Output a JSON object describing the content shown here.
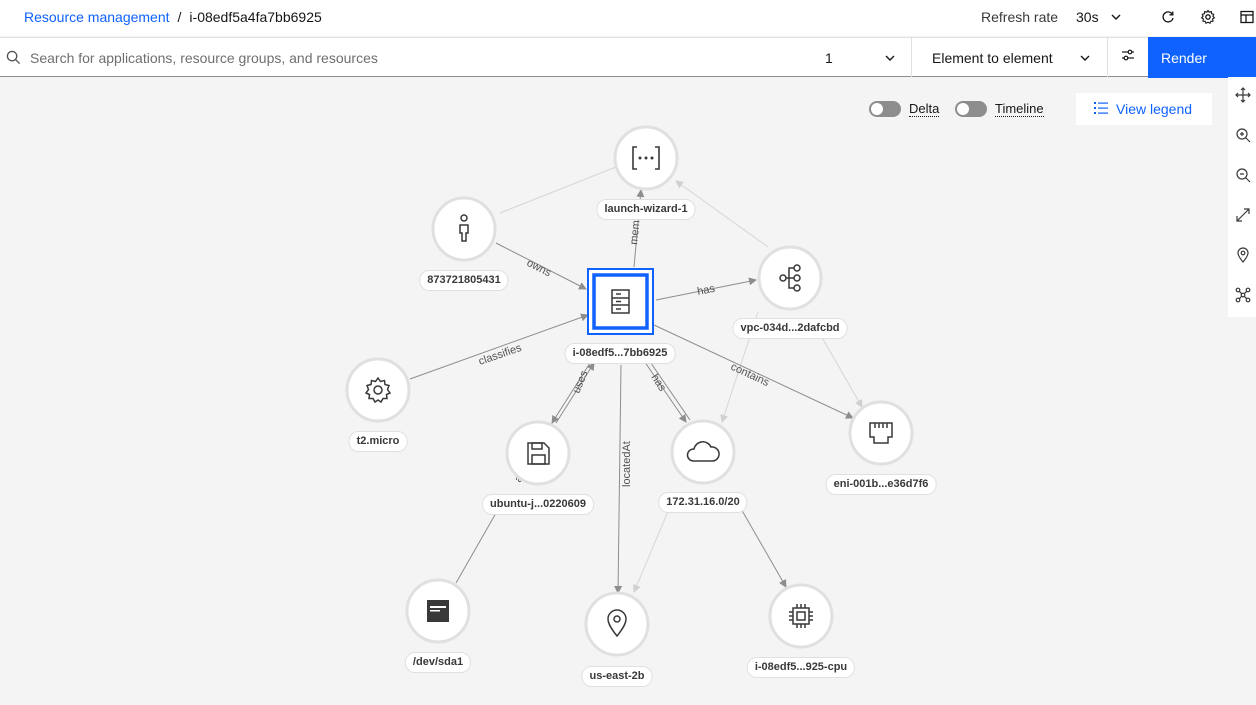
{
  "breadcrumb": {
    "parent": "Resource management",
    "separator": "/",
    "current": "i-08edf5a4fa7bb6925"
  },
  "header": {
    "refresh_label": "Refresh rate",
    "refresh_value": "30s"
  },
  "search": {
    "placeholder": "Search for applications, resource groups, and resources",
    "value": ""
  },
  "controls": {
    "depth_value": "1",
    "relation_type": "Element to element",
    "render_label": "Render"
  },
  "toggles": {
    "delta_label": "Delta",
    "timeline_label": "Timeline",
    "delta_on": false,
    "timeline_on": false
  },
  "legend_label": "View legend",
  "colors": {
    "accent": "#0f62fe",
    "canvas_bg": "#f4f4f4",
    "edge": "#8d8d8d"
  },
  "nodes": {
    "center": {
      "label": "i-08edf5...7bb6925",
      "icon": "server-icon",
      "selected": true
    },
    "sg": {
      "label": "launch-wizard-1",
      "icon": "code-brackets-icon"
    },
    "owner": {
      "label": "873721805431",
      "icon": "user-icon"
    },
    "vpc": {
      "label": "vpc-034d...2dafcbd",
      "icon": "network-tree-icon"
    },
    "type": {
      "label": "t2.micro",
      "icon": "gear-icon"
    },
    "image": {
      "label": "ubuntu-j...0220609",
      "icon": "floppy-disk-icon"
    },
    "subnet": {
      "label": "172.31.16.0/20",
      "icon": "cloud-icon"
    },
    "eni": {
      "label": "eni-001b...e36d7f6",
      "icon": "ethernet-port-icon"
    },
    "disk": {
      "label": "/dev/sda1",
      "icon": "volume-icon"
    },
    "zone": {
      "label": "us-east-2b",
      "icon": "location-pin-icon"
    },
    "cpu": {
      "label": "i-08edf5...925-cpu",
      "icon": "chip-icon"
    }
  },
  "edges": {
    "member": "membe",
    "owns": "owns",
    "has_vpc": "has",
    "classifies": "classifies",
    "uses": "uses",
    "located": "locatedAt",
    "has_subnet": "has",
    "contains": "contains",
    "image_disk": "a"
  }
}
